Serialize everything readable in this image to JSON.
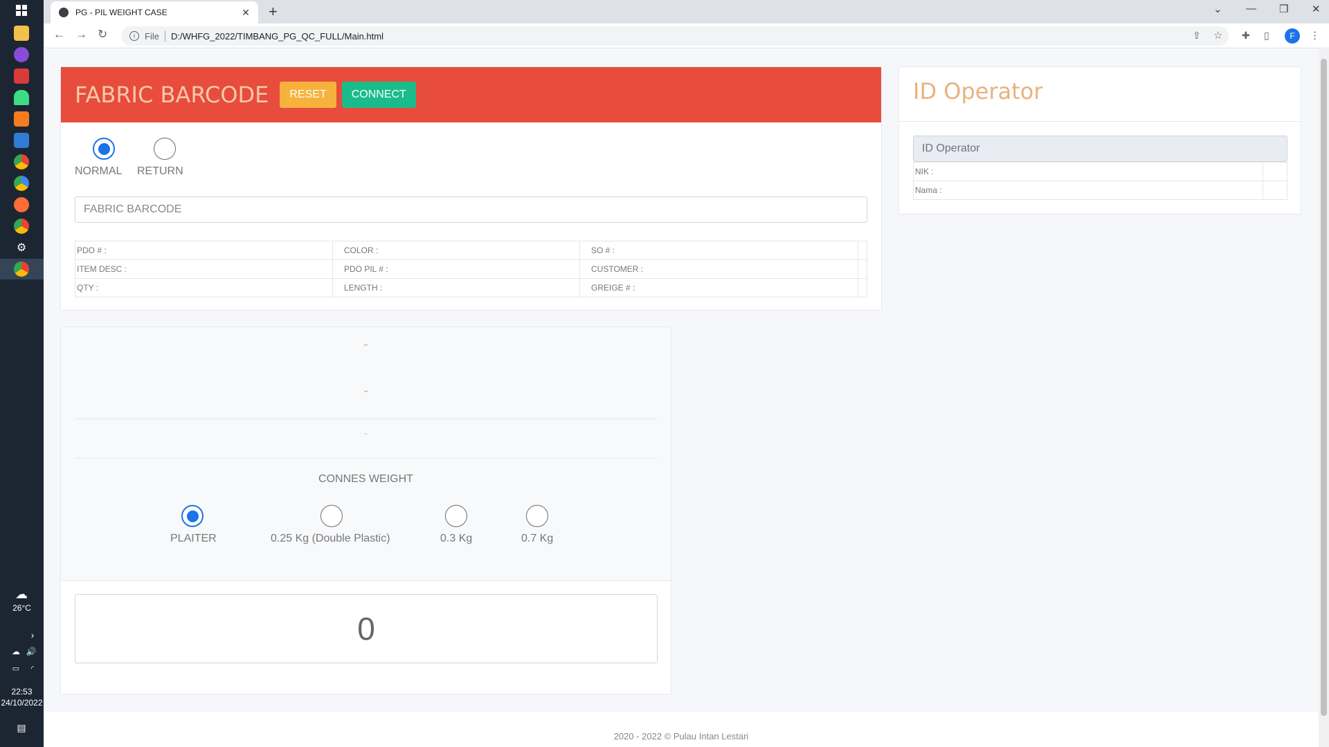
{
  "browser": {
    "tab_title": "PG - PIL WEIGHT CASE",
    "tab_close": "✕",
    "new_tab": "+",
    "url_scheme": "File",
    "url_path": "D:/WHFG_2022/TIMBANG_PG_QC_FULL/Main.html",
    "profile_initial": "F"
  },
  "taskbar": {
    "weather_temp": "26°C",
    "time": "22:53",
    "date": "24/10/2022"
  },
  "barcode_panel": {
    "title": "FABRIC BARCODE",
    "reset_label": "RESET",
    "connect_label": "CONNECT",
    "mode_options": [
      {
        "label": "NORMAL",
        "checked": true
      },
      {
        "label": "RETURN",
        "checked": false
      }
    ],
    "barcode_placeholder": "FABRIC BARCODE",
    "fields": [
      [
        "PDO # :",
        "COLOR :",
        "SO # :"
      ],
      [
        "ITEM DESC :",
        "PDO PIL # :",
        "CUSTOMER :"
      ],
      [
        "QTY :",
        "LENGTH :",
        "GREIGE # :"
      ]
    ]
  },
  "operator_panel": {
    "title": "ID Operator",
    "input_placeholder": "ID Operator",
    "nik_label": "NIK :",
    "nama_label": "Nama :"
  },
  "weight_panel": {
    "display_1": "-",
    "display_2": "-",
    "display_3": "-",
    "cones_label": "CONNES WEIGHT",
    "cone_options": [
      {
        "label": "PLAITER",
        "checked": true
      },
      {
        "label": "0.25 Kg (Double Plastic)",
        "checked": false
      },
      {
        "label": "0.3 Kg",
        "checked": false
      },
      {
        "label": "0.7 Kg",
        "checked": false
      }
    ],
    "weight_value": "0"
  },
  "footer": {
    "text": "2020 - 2022 © Pulau Intan Lestari"
  },
  "colors": {
    "header_red": "#e74c3c",
    "reset_yellow": "#f6b23c",
    "connect_green": "#1bbc8b",
    "operator_title": "#e8b27d",
    "radio_blue": "#1a73e8"
  }
}
